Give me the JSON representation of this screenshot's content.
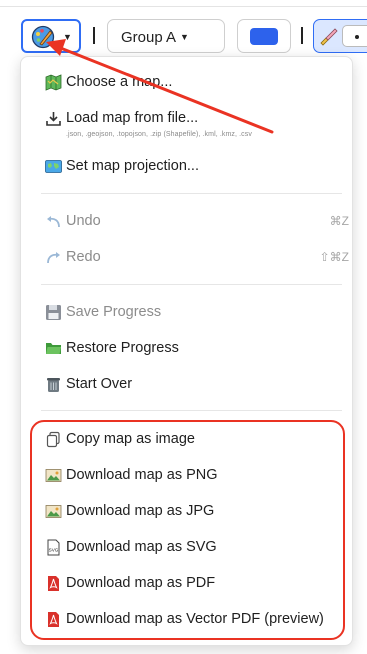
{
  "toolbar": {
    "menu_button_icon": "palette-icon",
    "group_select": {
      "value": "Group A"
    },
    "color_swatch": "#2d62ec",
    "active_tool_icon": "eraser-icon"
  },
  "menu": {
    "choose_map": {
      "label": "Choose a map...",
      "icon": "map-icon"
    },
    "load_map": {
      "label": "Load map from file...",
      "hint": ".json, .geojson, .topojson, .zip (Shapefile), .kml, .kmz, .csv",
      "icon": "download-icon"
    },
    "set_projection": {
      "label": "Set map projection...",
      "icon": "world-map-icon"
    },
    "undo": {
      "label": "Undo",
      "shortcut": "⌘Z",
      "icon": "undo-icon"
    },
    "redo": {
      "label": "Redo",
      "shortcut": "⇧⌘Z",
      "icon": "redo-icon"
    },
    "save_progress": {
      "label": "Save Progress",
      "icon": "floppy-disk-icon"
    },
    "restore_progress": {
      "label": "Restore Progress",
      "icon": "folder-icon"
    },
    "start_over": {
      "label": "Start Over",
      "icon": "trash-icon"
    },
    "copy_image": {
      "label": "Copy map as image",
      "icon": "copy-icon"
    },
    "download_png": {
      "label": "Download map as PNG",
      "icon": "image-icon"
    },
    "download_jpg": {
      "label": "Download map as JPG",
      "icon": "image-icon"
    },
    "download_svg": {
      "label": "Download map as SVG",
      "icon": "svg-file-icon"
    },
    "download_pdf": {
      "label": "Download map as PDF",
      "icon": "pdf-file-icon"
    },
    "download_vector_pdf": {
      "label": "Download map as Vector PDF (preview)",
      "icon": "pdf-file-icon"
    }
  },
  "annotation": {
    "color": "#ea3323"
  }
}
